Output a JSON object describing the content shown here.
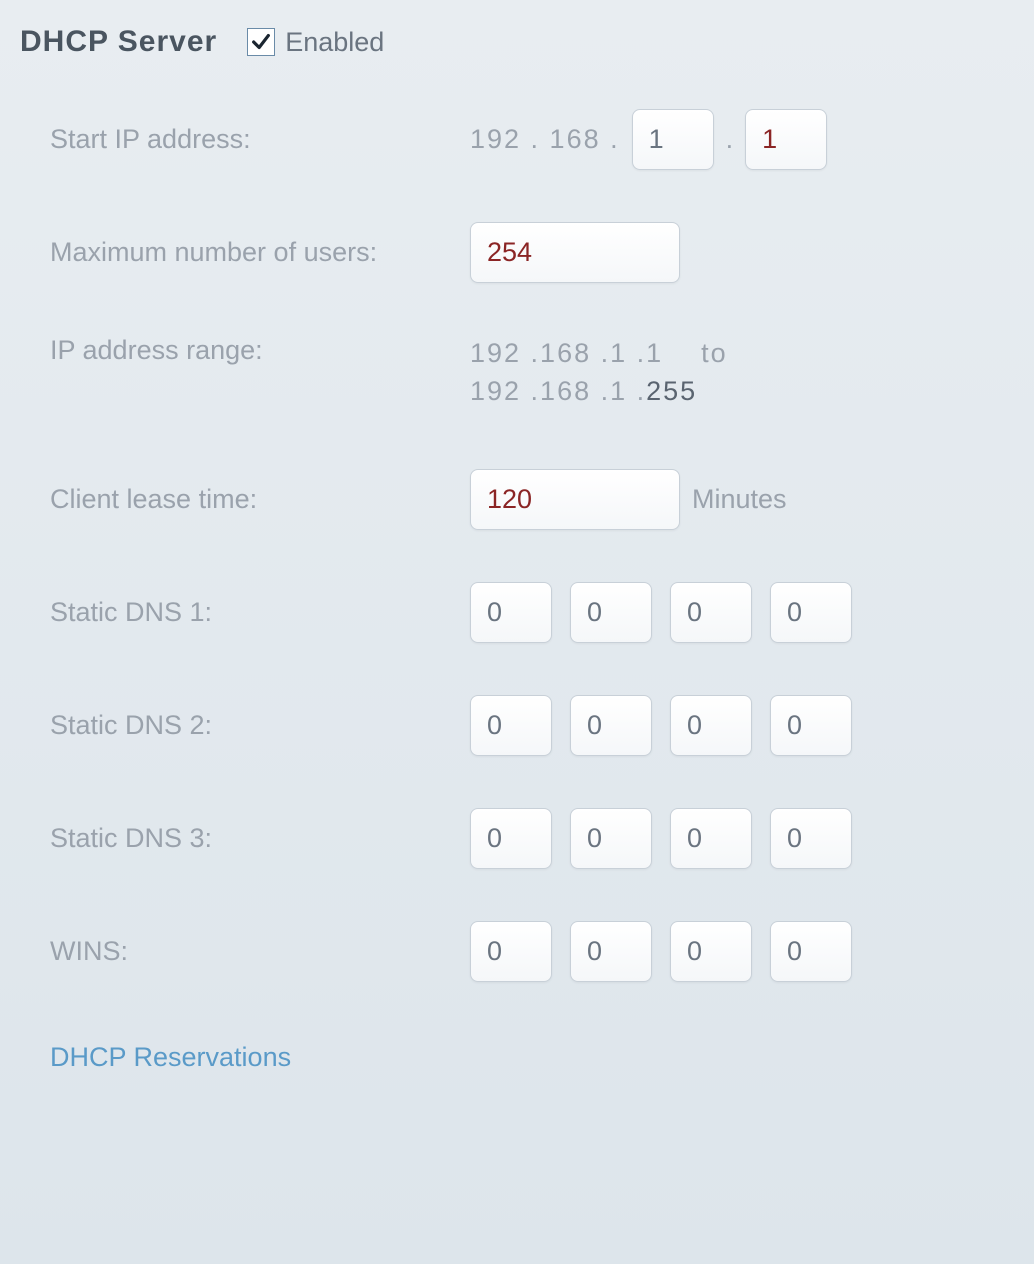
{
  "header": {
    "title": "DHCP Server",
    "enabled_label": "Enabled",
    "enabled_checked": true
  },
  "start_ip": {
    "label": "Start IP address:",
    "prefix": "192 . 168 .",
    "octet3": "1",
    "octet4": "1"
  },
  "max_users": {
    "label": "Maximum number of users:",
    "value": "254"
  },
  "ip_range": {
    "label": "IP address range:",
    "from_prefix": "192 .168 .1 .1",
    "to_word": "to",
    "to_prefix": "192 .168 .1 .",
    "to_last": "255"
  },
  "lease_time": {
    "label": "Client lease time:",
    "value": "120",
    "unit": "Minutes"
  },
  "dns1": {
    "label": "Static DNS 1:",
    "o1": "0",
    "o2": "0",
    "o3": "0",
    "o4": "0"
  },
  "dns2": {
    "label": "Static DNS 2:",
    "o1": "0",
    "o2": "0",
    "o3": "0",
    "o4": "0"
  },
  "dns3": {
    "label": "Static DNS 3:",
    "o1": "0",
    "o2": "0",
    "o3": "0",
    "o4": "0"
  },
  "wins": {
    "label": "WINS:",
    "o1": "0",
    "o2": "0",
    "o3": "0",
    "o4": "0"
  },
  "reservations_link": "DHCP Reservations"
}
